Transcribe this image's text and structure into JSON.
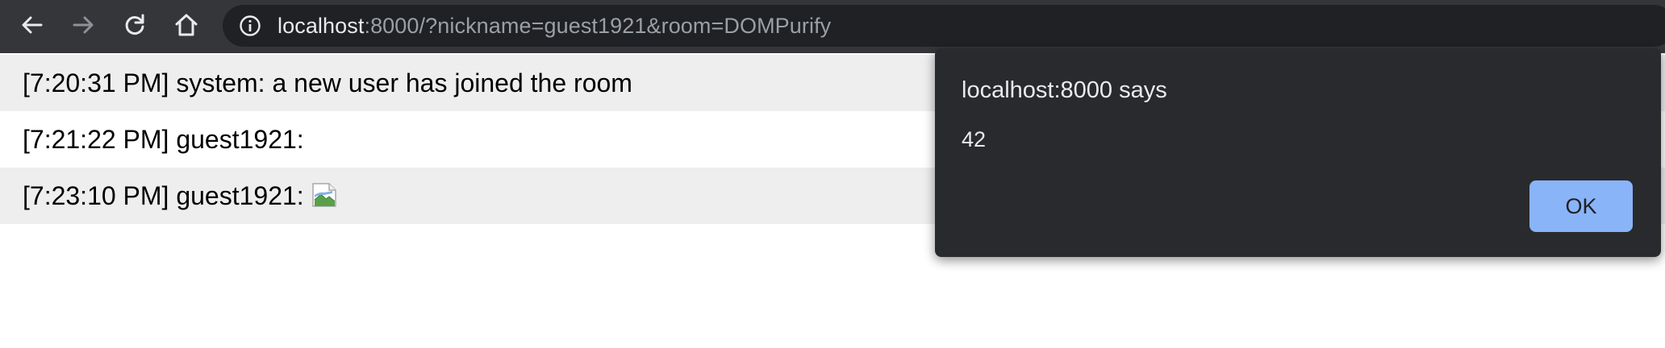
{
  "browser": {
    "url_host": "localhost",
    "url_rest": ":8000/?nickname=guest1921&room=DOMPurify",
    "icons": {
      "back": "back-arrow-icon",
      "forward": "forward-arrow-icon",
      "reload": "reload-icon",
      "home": "home-icon",
      "site_info": "info-icon"
    }
  },
  "chat": {
    "messages": [
      {
        "time": "[7:20:31 PM]",
        "author": "system:",
        "text": "a new user has joined the room"
      },
      {
        "time": "[7:21:22 PM]",
        "author": "guest1921:",
        "text": ""
      },
      {
        "time": "[7:23:10 PM]",
        "author": "guest1921:",
        "text": "",
        "image": "broken-image-icon"
      }
    ]
  },
  "dialog": {
    "title": "localhost:8000 says",
    "message": "42",
    "ok_label": "OK"
  },
  "colors": {
    "toolbar": "#35363a",
    "omnibox": "#202124",
    "dialog_bg": "#292a2d",
    "ok_button": "#8ab4f8",
    "alt_row": "#eeeeee"
  }
}
